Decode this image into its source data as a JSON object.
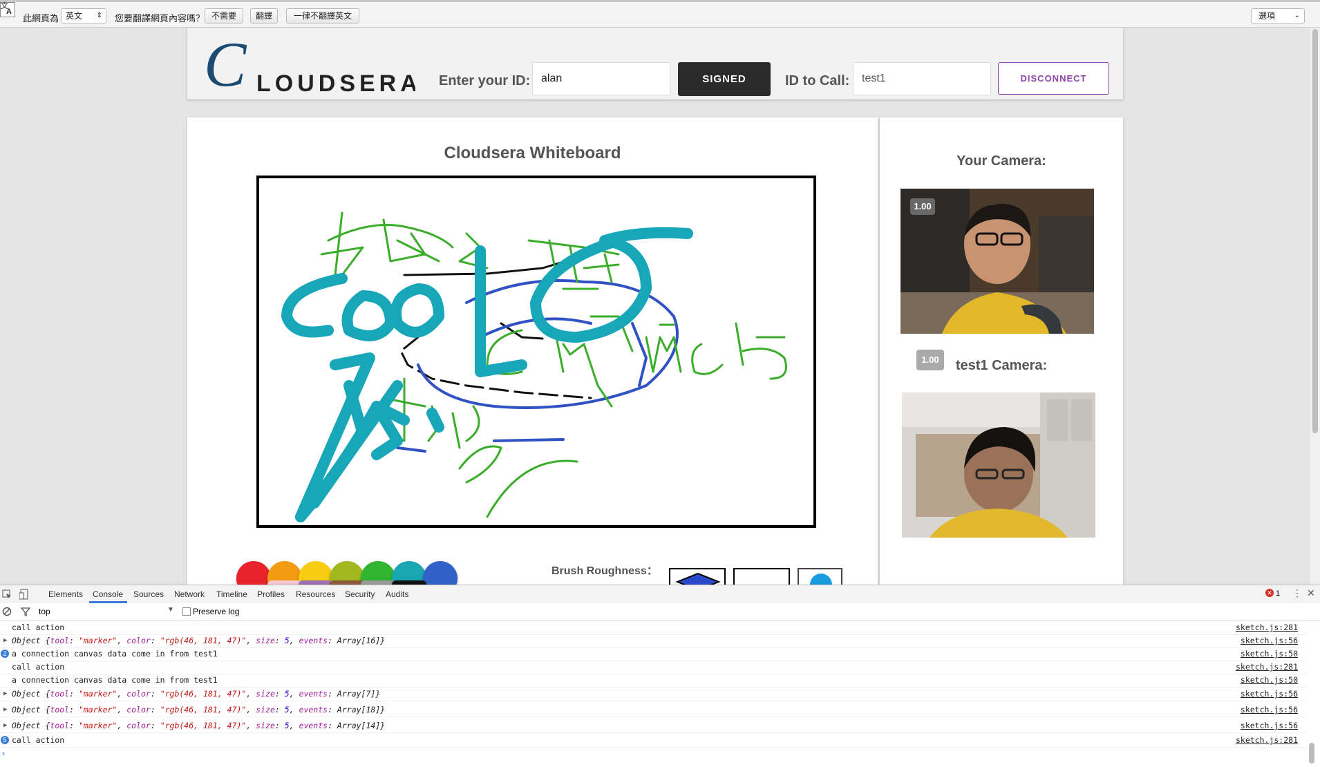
{
  "translate_bar": {
    "page_language_label": "此網頁為",
    "language_value": "英文",
    "question": "您要翻譯網頁內容嗎？",
    "btn_no": "不需要",
    "btn_translate": "翻譯",
    "btn_never": "一律不翻譯英文",
    "options": "選項"
  },
  "header": {
    "logo_text": "LOUDSERA",
    "logo_letter": "C",
    "enter_id_label": "Enter your ID:",
    "id_value": "alan",
    "signed_label": "SIGNED",
    "id_to_call_label": "ID to Call:",
    "call_id_value": "test1",
    "disconnect_label": "DISCONNECT"
  },
  "whiteboard": {
    "title": "Cloudsera Whiteboard",
    "colors": [
      "#e8232a",
      "#f39a13",
      "#f7cc12",
      "#a2b81f",
      "#2fb52f",
      "#1aa7b3",
      "#3260c9"
    ],
    "colors_row2": [
      "#f4c6d2",
      "#9b6fb1",
      "#8a5a3b",
      "#999999",
      "#111111"
    ],
    "brush_label": "Brush Roughness："
  },
  "cameras": {
    "your_title": "Your Camera:",
    "your_zoom": "1.00",
    "remote_title": "test1 Camera:",
    "remote_zoom": "1.00"
  },
  "devtools": {
    "tabs": [
      "Elements",
      "Console",
      "Sources",
      "Network",
      "Timeline",
      "Profiles",
      "Resources",
      "Security",
      "Audits"
    ],
    "active_tab": "Console",
    "context": "top",
    "preserve_log": "Preserve log",
    "error_count": "1",
    "logs": [
      {
        "text": "call action",
        "src": "sketch.js:281"
      },
      {
        "text": "Object {tool: \"marker\", color: \"rgb(46, 181, 47)\", size: 5, events: Array[16]}",
        "src": "sketch.js:56"
      },
      {
        "text": "a connection canvas data come in from test1",
        "src": "sketch.js:50",
        "count": "2"
      },
      {
        "text": "call action",
        "src": "sketch.js:281"
      },
      {
        "text": "a connection canvas data come in from test1",
        "src": "sketch.js:50"
      },
      {
        "text": "Object {tool: \"marker\", color: \"rgb(46, 181, 47)\", size: 5, events: Array[7]}",
        "src": "sketch.js:56"
      },
      {
        "text": "Object {tool: \"marker\", color: \"rgb(46, 181, 47)\", size: 5, events: Array[18]}",
        "src": "sketch.js:56"
      },
      {
        "text": "Object {tool: \"marker\", color: \"rgb(46, 181, 47)\", size: 5, events: Array[14]}",
        "src": "sketch.js:56"
      },
      {
        "text": "call action",
        "src": "sketch.js:281",
        "count": "5"
      }
    ]
  }
}
